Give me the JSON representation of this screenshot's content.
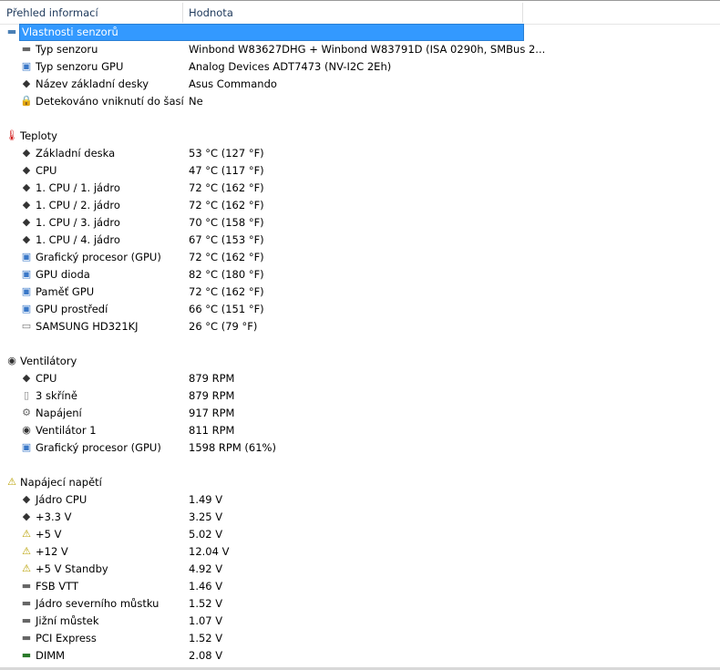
{
  "header": {
    "col1": "Přehled informací",
    "col2": "Hodnota"
  },
  "rows": [
    {
      "type": "group",
      "icon": "sensor-chip-icon",
      "label": "Vlastnosti senzorů",
      "value": "",
      "selected": true
    },
    {
      "type": "child",
      "icon": "chip-icon",
      "label": "Typ senzoru",
      "value": "Winbond W83627DHG + Winbond W83791D  (ISA 0290h, SMBus 2..."
    },
    {
      "type": "child",
      "icon": "monitor-icon",
      "label": "Typ senzoru GPU",
      "value": "Analog Devices ADT7473  (NV-I2C 2Eh)"
    },
    {
      "type": "child",
      "icon": "motherboard-icon",
      "label": "Název základní desky",
      "value": "Asus Commando"
    },
    {
      "type": "child",
      "icon": "lock-icon",
      "label": "Detekováno vniknutí do šasí",
      "value": "Ne"
    },
    {
      "type": "blank"
    },
    {
      "type": "group",
      "icon": "thermometer-icon",
      "label": "Teploty",
      "value": ""
    },
    {
      "type": "child",
      "icon": "motherboard-icon",
      "label": "Základní deska",
      "value": "53 °C  (127 °F)"
    },
    {
      "type": "child",
      "icon": "cpu-icon",
      "label": "CPU",
      "value": "47 °C  (117 °F)"
    },
    {
      "type": "child",
      "icon": "cpu-icon",
      "label": "1. CPU / 1. jádro",
      "value": "72 °C  (162 °F)"
    },
    {
      "type": "child",
      "icon": "cpu-icon",
      "label": "1. CPU / 2. jádro",
      "value": "72 °C  (162 °F)"
    },
    {
      "type": "child",
      "icon": "cpu-icon",
      "label": "1. CPU / 3. jádro",
      "value": "70 °C  (158 °F)"
    },
    {
      "type": "child",
      "icon": "cpu-icon",
      "label": "1. CPU / 4. jádro",
      "value": "67 °C  (153 °F)"
    },
    {
      "type": "child",
      "icon": "monitor-icon",
      "label": "Grafický procesor (GPU)",
      "value": "72 °C  (162 °F)"
    },
    {
      "type": "child",
      "icon": "monitor-icon",
      "label": "GPU dioda",
      "value": "82 °C  (180 °F)"
    },
    {
      "type": "child",
      "icon": "monitor-icon",
      "label": "Paměť GPU",
      "value": "72 °C  (162 °F)"
    },
    {
      "type": "child",
      "icon": "monitor-icon",
      "label": "GPU prostředí",
      "value": "66 °C  (151 °F)"
    },
    {
      "type": "child",
      "icon": "hard-drive-icon",
      "label": "SAMSUNG HD321KJ",
      "value": "26 °C  (79 °F)"
    },
    {
      "type": "blank"
    },
    {
      "type": "group",
      "icon": "fan-icon",
      "label": "Ventilátory",
      "value": ""
    },
    {
      "type": "child",
      "icon": "cpu-icon",
      "label": "CPU",
      "value": "879 RPM"
    },
    {
      "type": "child",
      "icon": "case-icon",
      "label": "3 skříně",
      "value": "879 RPM"
    },
    {
      "type": "child",
      "icon": "power-supply-icon",
      "label": "Napájení",
      "value": "917 RPM"
    },
    {
      "type": "child",
      "icon": "fan-icon",
      "label": "Ventilátor 1",
      "value": "811 RPM"
    },
    {
      "type": "child",
      "icon": "monitor-icon",
      "label": "Grafický procesor (GPU)",
      "value": "1598 RPM  (61%)"
    },
    {
      "type": "blank"
    },
    {
      "type": "group",
      "icon": "voltage-warning-icon",
      "label": "Napájecí napětí",
      "value": ""
    },
    {
      "type": "child",
      "icon": "cpu-icon",
      "label": "Jádro CPU",
      "value": "1.49 V"
    },
    {
      "type": "child",
      "icon": "cpu-icon",
      "label": "+3.3 V",
      "value": "3.25 V"
    },
    {
      "type": "child",
      "icon": "voltage-warning-icon",
      "label": "+5 V",
      "value": "5.02 V"
    },
    {
      "type": "child",
      "icon": "voltage-warning-icon",
      "label": "+12 V",
      "value": "12.04 V"
    },
    {
      "type": "child",
      "icon": "voltage-warning-icon",
      "label": "+5 V Standby",
      "value": "4.92 V"
    },
    {
      "type": "child",
      "icon": "chip-icon",
      "label": "FSB VTT",
      "value": "1.46 V"
    },
    {
      "type": "child",
      "icon": "chip-icon",
      "label": "Jádro severního můstku",
      "value": "1.52 V"
    },
    {
      "type": "child",
      "icon": "chip-icon",
      "label": "Jižní můstek",
      "value": "1.07 V"
    },
    {
      "type": "child",
      "icon": "chip-icon",
      "label": "PCI Express",
      "value": "1.52 V"
    },
    {
      "type": "child",
      "icon": "memory-icon",
      "label": "DIMM",
      "value": "2.08 V"
    }
  ]
}
